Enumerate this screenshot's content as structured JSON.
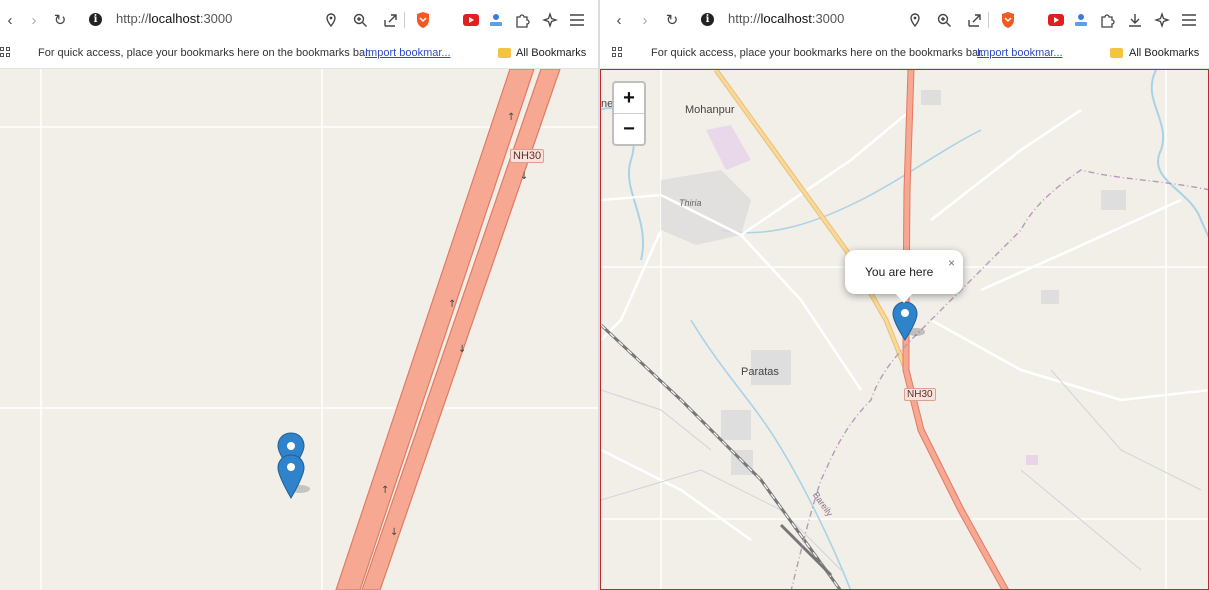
{
  "left_window": {
    "url_prefix": "http://",
    "url_host": "localhost",
    "url_port": ":3000",
    "bookmarks_prompt": "For quick access, place your bookmarks here on the bookmarks bar.",
    "import_link": "Import bookmar...",
    "all_bookmarks": "All Bookmarks",
    "map_labels": {
      "road_shield": "NH30"
    }
  },
  "right_window": {
    "url_prefix": "http://",
    "url_host": "localhost",
    "url_port": ":3000",
    "bookmarks_prompt": "For quick access, place your bookmarks here on the bookmarks bar.",
    "import_link": "Import bookmar...",
    "all_bookmarks": "All Bookmarks",
    "zoom_in": "+",
    "zoom_out": "−",
    "popup_text": "You are here",
    "popup_close": "×",
    "map_labels": {
      "mohanpur": "Mohanpur",
      "thiria": "Thiria",
      "paratas": "Paratas",
      "road_shield": "NH30",
      "river": "Bareily",
      "edge": "ne"
    }
  },
  "icons": {
    "back": "chevron-left-icon",
    "forward": "chevron-right-icon",
    "reload": "reload-icon",
    "info": "info-icon",
    "location": "location-icon",
    "zoom": "zoom-icon",
    "share": "share-icon",
    "brave": "brave-shield-icon",
    "youtube": "youtube-extension-icon",
    "extension": "extension-icon",
    "puzzle": "puzzle-icon",
    "download": "download-icon",
    "leo": "leo-ai-icon",
    "menu": "menu-icon",
    "apps": "apps-grid-icon",
    "folder": "folder-icon",
    "marker": "map-marker-icon"
  },
  "colors": {
    "map_background": "#f2efe9",
    "highway_fill": "#f7a893",
    "highway_casing": "#e07b63",
    "marker_blue": "#2f83cb",
    "river": "#a8d3e6",
    "link": "#2a4cc9"
  }
}
